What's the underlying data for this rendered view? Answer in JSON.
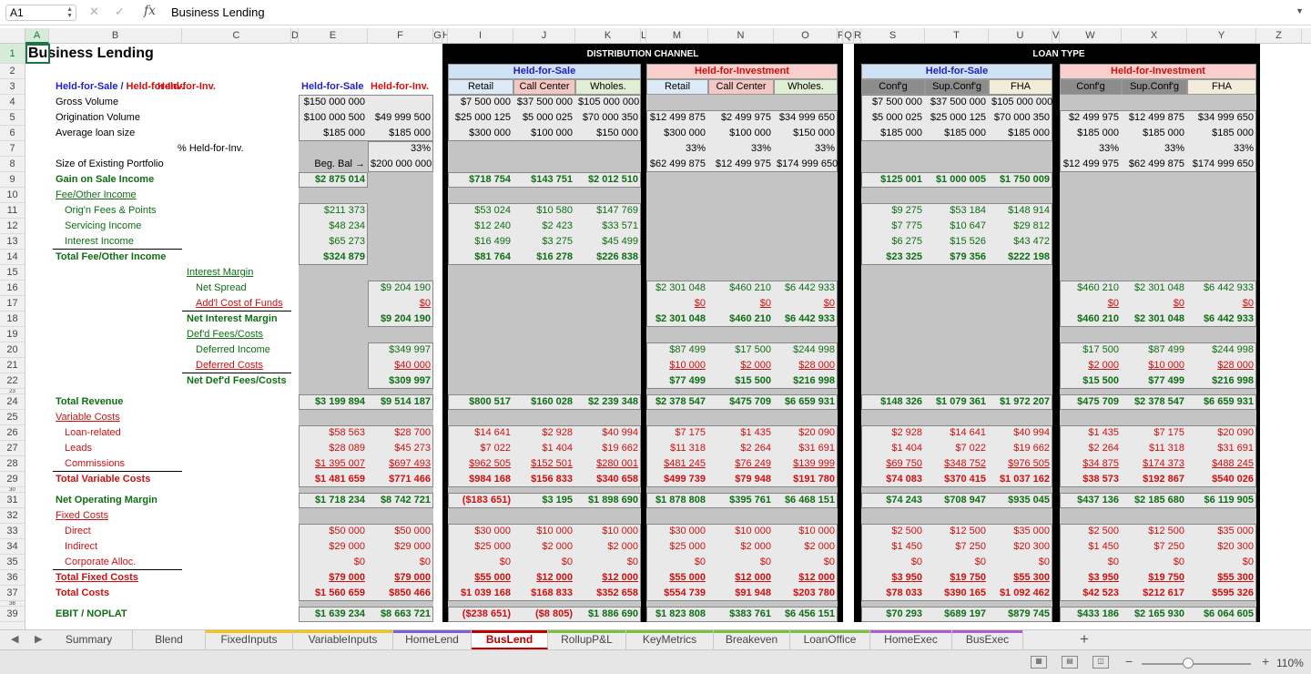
{
  "formula_bar": {
    "name_box": "A1",
    "fx": "fx",
    "content": "Business Lending"
  },
  "columns": [
    "A",
    "B",
    "C",
    "D",
    "E",
    "F",
    "G",
    "H",
    "I",
    "J",
    "K",
    "L",
    "M",
    "N",
    "O",
    "P",
    "Q",
    "R",
    "S",
    "T",
    "U",
    "V",
    "W",
    "X",
    "Y",
    "Z"
  ],
  "rows": [
    "1",
    "2",
    "3",
    "4",
    "5",
    "6",
    "7",
    "8",
    "9",
    "10",
    "11",
    "12",
    "13",
    "14",
    "15",
    "16",
    "17",
    "18",
    "19",
    "20",
    "21",
    "22",
    "23",
    "24",
    "25",
    "26",
    "27",
    "28",
    "29",
    "30",
    "31",
    "32",
    "33",
    "34",
    "35",
    "36",
    "37",
    "38",
    "39"
  ],
  "sheet_title": "Business Lending",
  "headers": {
    "hfs_slash": "Held-for-Sale",
    "slash": "/",
    "hfi_slash": "Held-for-Inv.",
    "c3": "Held-for-Inv.",
    "e3": "Held-for-Sale",
    "f3": "Held-for-Inv.",
    "distribution_channel": "DISTRIBUTION CHANNEL",
    "loan_type": "LOAN TYPE",
    "hfs": "Held-for-Sale",
    "hfi": "Held-for-Investment",
    "dist_sub": [
      "Retail",
      "Call Center",
      "Wholes.",
      "Retail",
      "Call Center",
      "Wholes."
    ],
    "loan_sub": [
      "Conf'g",
      "Sup.Conf'g",
      "FHA",
      "Conf'g",
      "Sup.Conf'g",
      "FHA"
    ]
  },
  "labels": {
    "gross_volume": "Gross Volume",
    "origination_volume": "Origination Volume",
    "average_loan_size": "Average loan size",
    "pct_hfi": "% Held-for-Inv.",
    "size_existing": "Size of Existing Portfolio",
    "beg_bal": "Beg. Bal →",
    "gain_on_sale": "Gain on Sale Income",
    "fee_other": "Fee/Other Income",
    "orig_fees": "Orig'n Fees & Points",
    "servicing": "Servicing Income",
    "interest_income": "Interest Income",
    "total_fee": "Total Fee/Other Income",
    "interest_margin": "Interest Margin",
    "net_spread": "Net Spread",
    "addl_cof": "Add'l Cost of Funds",
    "net_interest_margin": "Net Interest Margin",
    "defd_fees": "Def'd Fees/Costs",
    "deferred_income": "Deferred Income",
    "deferred_costs": "Deferred Costs",
    "net_defd": "Net Def'd Fees/Costs",
    "total_revenue": "Total Revenue",
    "variable_costs": "Variable Costs",
    "loan_related": "Loan-related",
    "leads": "Leads",
    "commissions": "Commissions",
    "total_variable": "Total Variable Costs",
    "net_operating_margin": "Net Operating Margin",
    "fixed_costs": "Fixed Costs",
    "direct": "Direct",
    "indirect": "Indirect",
    "corporate_alloc": "Corporate Alloc.",
    "total_fixed": "Total Fixed Costs",
    "total_costs": "Total Costs",
    "ebit": "EBIT / NOPLAT"
  },
  "values": {
    "r4": {
      "E": "$150 000 000",
      "I": "$7 500 000",
      "J": "$37 500 000",
      "K": "$105 000 000",
      "S": "$7 500 000",
      "T": "$37 500 000",
      "U": "$105 000 000"
    },
    "r5": {
      "E": "$100 000 500",
      "F": "$49 999 500",
      "I": "$25 000 125",
      "J": "$5 000 025",
      "K": "$70 000 350",
      "M": "$12 499 875",
      "N": "$2 499 975",
      "O": "$34 999 650",
      "S": "$5 000 025",
      "T": "$25 000 125",
      "U": "$70 000 350",
      "W": "$2 499 975",
      "X": "$12 499 875",
      "Y": "$34 999 650"
    },
    "r6": {
      "E": "$185 000",
      "F": "$185 000",
      "I": "$300 000",
      "J": "$100 000",
      "K": "$150 000",
      "M": "$300 000",
      "N": "$100 000",
      "O": "$150 000",
      "S": "$185 000",
      "T": "$185 000",
      "U": "$185 000",
      "W": "$185 000",
      "X": "$185 000",
      "Y": "$185 000"
    },
    "r7": {
      "F": "33%",
      "M": "33%",
      "N": "33%",
      "O": "33%",
      "W": "33%",
      "X": "33%",
      "Y": "33%"
    },
    "r8": {
      "F": "$200 000 000",
      "M": "$62 499 875",
      "N": "$12 499 975",
      "O": "$174 999 650",
      "W": "$12 499 975",
      "X": "$62 499 875",
      "Y": "$174 999 650"
    },
    "r9": {
      "E": "$2 875 014",
      "I": "$718 754",
      "J": "$143 751",
      "K": "$2 012 510",
      "S": "$125 001",
      "T": "$1 000 005",
      "U": "$1 750 009"
    },
    "r11": {
      "E": "$211 373",
      "I": "$53 024",
      "J": "$10 580",
      "K": "$147 769",
      "S": "$9 275",
      "T": "$53 184",
      "U": "$148 914"
    },
    "r12": {
      "E": "$48 234",
      "I": "$12 240",
      "J": "$2 423",
      "K": "$33 571",
      "S": "$7 775",
      "T": "$10 647",
      "U": "$29 812"
    },
    "r13": {
      "E": "$65 273",
      "I": "$16 499",
      "J": "$3 275",
      "K": "$45 499",
      "S": "$6 275",
      "T": "$15 526",
      "U": "$43 472"
    },
    "r14": {
      "E": "$324 879",
      "I": "$81 764",
      "J": "$16 278",
      "K": "$226 838",
      "S": "$23 325",
      "T": "$79 356",
      "U": "$222 198"
    },
    "r16": {
      "F": "$9 204 190",
      "M": "$2 301 048",
      "N": "$460 210",
      "O": "$6 442 933",
      "W": "$460 210",
      "X": "$2 301 048",
      "Y": "$6 442 933"
    },
    "r17": {
      "F": "$0",
      "M": "$0",
      "N": "$0",
      "O": "$0",
      "W": "$0",
      "X": "$0",
      "Y": "$0"
    },
    "r18": {
      "F": "$9 204 190",
      "M": "$2 301 048",
      "N": "$460 210",
      "O": "$6 442 933",
      "W": "$460 210",
      "X": "$2 301 048",
      "Y": "$6 442 933"
    },
    "r20": {
      "F": "$349 997",
      "M": "$87 499",
      "N": "$17 500",
      "O": "$244 998",
      "W": "$17 500",
      "X": "$87 499",
      "Y": "$244 998"
    },
    "r21": {
      "F": "$40 000",
      "M": "$10 000",
      "N": "$2 000",
      "O": "$28 000",
      "W": "$2 000",
      "X": "$10 000",
      "Y": "$28 000"
    },
    "r22": {
      "F": "$309 997",
      "M": "$77 499",
      "N": "$15 500",
      "O": "$216 998",
      "W": "$15 500",
      "X": "$77 499",
      "Y": "$216 998"
    },
    "r24": {
      "E": "$3 199 894",
      "F": "$9 514 187",
      "I": "$800 517",
      "J": "$160 028",
      "K": "$2 239 348",
      "M": "$2 378 547",
      "N": "$475 709",
      "O": "$6 659 931",
      "S": "$148 326",
      "T": "$1 079 361",
      "U": "$1 972 207",
      "W": "$475 709",
      "X": "$2 378 547",
      "Y": "$6 659 931"
    },
    "r26": {
      "E": "$58 563",
      "F": "$28 700",
      "I": "$14 641",
      "J": "$2 928",
      "K": "$40 994",
      "M": "$7 175",
      "N": "$1 435",
      "O": "$20 090",
      "S": "$2 928",
      "T": "$14 641",
      "U": "$40 994",
      "W": "$1 435",
      "X": "$7 175",
      "Y": "$20 090"
    },
    "r27": {
      "E": "$28 089",
      "F": "$45 273",
      "I": "$7 022",
      "J": "$1 404",
      "K": "$19 662",
      "M": "$11 318",
      "N": "$2 264",
      "O": "$31 691",
      "S": "$1 404",
      "T": "$7 022",
      "U": "$19 662",
      "W": "$2 264",
      "X": "$11 318",
      "Y": "$31 691"
    },
    "r28": {
      "E": "$1 395 007",
      "F": "$697 493",
      "I": "$962 505",
      "J": "$152 501",
      "K": "$280 001",
      "M": "$481 245",
      "N": "$76 249",
      "O": "$139 999",
      "S": "$69 750",
      "T": "$348 752",
      "U": "$976 505",
      "W": "$34 875",
      "X": "$174 373",
      "Y": "$488 245"
    },
    "r29": {
      "E": "$1 481 659",
      "F": "$771 466",
      "I": "$984 168",
      "J": "$156 833",
      "K": "$340 658",
      "M": "$499 739",
      "N": "$79 948",
      "O": "$191 780",
      "S": "$74 083",
      "T": "$370 415",
      "U": "$1 037 162",
      "W": "$38 573",
      "X": "$192 867",
      "Y": "$540 026"
    },
    "r31": {
      "E": "$1 718 234",
      "F": "$8 742 721",
      "I": "($183 651)",
      "J": "$3 195",
      "K": "$1 898 690",
      "M": "$1 878 808",
      "N": "$395 761",
      "O": "$6 468 151",
      "S": "$74 243",
      "T": "$708 947",
      "U": "$935 045",
      "W": "$437 136",
      "X": "$2 185 680",
      "Y": "$6 119 905"
    },
    "r33": {
      "E": "$50 000",
      "F": "$50 000",
      "I": "$30 000",
      "J": "$10 000",
      "K": "$10 000",
      "M": "$30 000",
      "N": "$10 000",
      "O": "$10 000",
      "S": "$2 500",
      "T": "$12 500",
      "U": "$35 000",
      "W": "$2 500",
      "X": "$12 500",
      "Y": "$35 000"
    },
    "r34": {
      "E": "$29 000",
      "F": "$29 000",
      "I": "$25 000",
      "J": "$2 000",
      "K": "$2 000",
      "M": "$25 000",
      "N": "$2 000",
      "O": "$2 000",
      "S": "$1 450",
      "T": "$7 250",
      "U": "$20 300",
      "W": "$1 450",
      "X": "$7 250",
      "Y": "$20 300"
    },
    "r35": {
      "E": "$0",
      "F": "$0",
      "I": "$0",
      "J": "$0",
      "K": "$0",
      "M": "$0",
      "N": "$0",
      "O": "$0",
      "S": "$0",
      "T": "$0",
      "U": "$0",
      "W": "$0",
      "X": "$0",
      "Y": "$0"
    },
    "r36": {
      "E": "$79 000",
      "F": "$79 000",
      "I": "$55 000",
      "J": "$12 000",
      "K": "$12 000",
      "M": "$55 000",
      "N": "$12 000",
      "O": "$12 000",
      "S": "$3 950",
      "T": "$19 750",
      "U": "$55 300",
      "W": "$3 950",
      "X": "$19 750",
      "Y": "$55 300"
    },
    "r37": {
      "E": "$1 560 659",
      "F": "$850 466",
      "I": "$1 039 168",
      "J": "$168 833",
      "K": "$352 658",
      "M": "$554 739",
      "N": "$91 948",
      "O": "$203 780",
      "S": "$78 033",
      "T": "$390 165",
      "U": "$1 092 462",
      "W": "$42 523",
      "X": "$212 617",
      "Y": "$595 326"
    },
    "r39": {
      "E": "$1 639 234",
      "F": "$8 663 721",
      "I": "($238 651)",
      "J": "($8 805)",
      "K": "$1 886 690",
      "M": "$1 823 808",
      "N": "$383 761",
      "O": "$6 456 151",
      "S": "$70 293",
      "T": "$689 197",
      "U": "$879 745",
      "W": "$433 186",
      "X": "$2 165 930",
      "Y": "$6 064 605"
    }
  },
  "tabs": [
    {
      "label": "Summary",
      "color": ""
    },
    {
      "label": "Blend",
      "color": ""
    },
    {
      "label": "FixedInputs",
      "color": "#f0c419"
    },
    {
      "label": "VariableInputs",
      "color": "#f0c419"
    },
    {
      "label": "HomeLend",
      "color": "#7a5fd6"
    },
    {
      "label": "BusLend",
      "color": "#c00000"
    },
    {
      "label": "RollupP&L",
      "color": "#7ac142"
    },
    {
      "label": "KeyMetrics",
      "color": "#7ac142"
    },
    {
      "label": "Breakeven",
      "color": "#7ac142"
    },
    {
      "label": "LoanOffice",
      "color": "#7ac142"
    },
    {
      "label": "HomeExec",
      "color": "#b05ad6"
    },
    {
      "label": "BusExec",
      "color": "#b05ad6"
    }
  ],
  "status": {
    "zoom": "110%",
    "minus": "−",
    "plus": "+"
  },
  "colors": {
    "hfs_bg": "#cfe2f3",
    "hfi_bg": "#f8cfcb",
    "sub_blue": "#dce9f7",
    "sub_red": "#f4c7c3",
    "sub_green": "#e0efd4",
    "sub_gray": "#8c8c8c",
    "sub_tan": "#f3ecd8",
    "green_text": "#0e6e14",
    "red_text": "#d01010",
    "blue_text": "#1f1fc8"
  }
}
